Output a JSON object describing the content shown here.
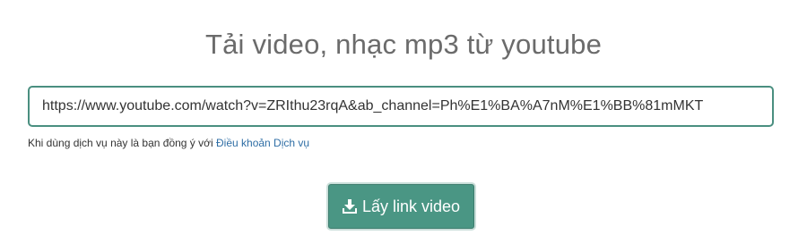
{
  "page": {
    "title": "Tải video, nhạc mp3 từ youtube"
  },
  "form": {
    "url_value": "https://www.youtube.com/watch?v=ZRIthu23rqA&ab_channel=Ph%E1%BA%A7nM%E1%BB%81mMKT",
    "terms_prefix": "Khi dùng dịch vụ này là bạn đồng ý với ",
    "terms_link": "Điều khoản Dịch vụ",
    "submit_label": "Lấy link video",
    "submit_icon": "download-icon"
  },
  "colors": {
    "accent": "#4a9684",
    "input_border": "#4a8f80",
    "title": "#6b6b6b",
    "link": "#2f6ea5"
  }
}
